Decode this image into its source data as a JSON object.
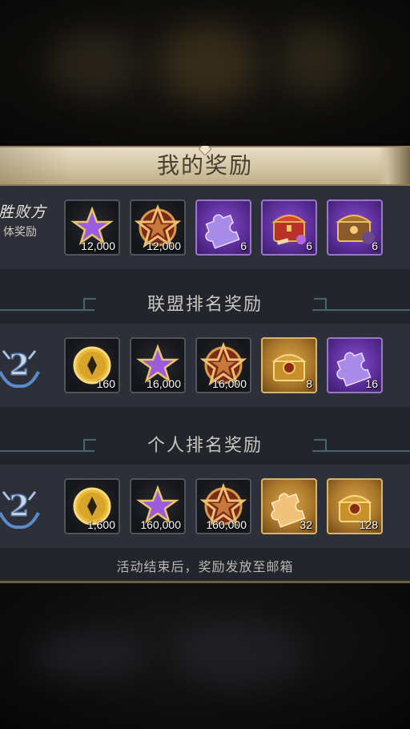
{
  "page": {
    "title": "我的奖励",
    "footer": "活动结束后，奖励发放至邮箱"
  },
  "team_row": {
    "label_line1": "胜败方",
    "label_line2": "体奖励",
    "items": [
      {
        "icon": "purple-star-icon",
        "qty": "12,000"
      },
      {
        "icon": "gold-star-medal-icon",
        "qty": "12,000"
      },
      {
        "icon": "purple-puzzle-piece-icon",
        "qty": "6"
      },
      {
        "icon": "red-treasure-chest-icon",
        "qty": "6"
      },
      {
        "icon": "gold-ornate-chest-icon",
        "qty": "6"
      }
    ]
  },
  "alliance_section": {
    "title": "联盟排名奖励",
    "rank": "2",
    "items": [
      {
        "icon": "gold-coin-icon",
        "qty": "160"
      },
      {
        "icon": "purple-star-icon",
        "qty": "16,000"
      },
      {
        "icon": "gold-star-medal-icon",
        "qty": "16,000"
      },
      {
        "icon": "gold-lion-chest-icon",
        "qty": "8"
      },
      {
        "icon": "purple-puzzle-piece-icon",
        "qty": "16"
      }
    ]
  },
  "personal_section": {
    "title": "个人排名奖励",
    "rank": "2",
    "items": [
      {
        "icon": "gold-coin-icon",
        "qty": "1,600"
      },
      {
        "icon": "purple-star-icon",
        "qty": "160,000"
      },
      {
        "icon": "gold-star-medal-icon",
        "qty": "160,000"
      },
      {
        "icon": "gold-puzzle-piece-icon",
        "qty": "32"
      },
      {
        "icon": "gold-lion-chest-icon",
        "qty": "128"
      }
    ]
  },
  "colors": {
    "panel_bg": "#22252c",
    "row_bg": "#2d3038",
    "title_bar": "#d3c6a5",
    "accent_line": "#4a6170"
  }
}
